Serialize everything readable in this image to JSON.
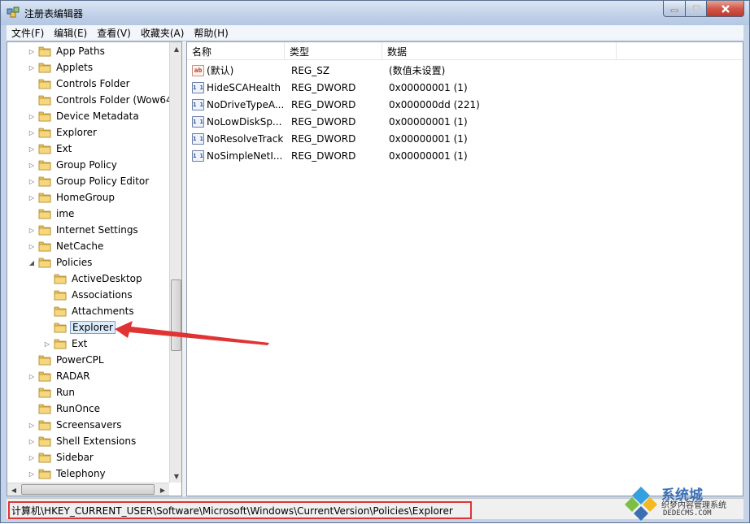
{
  "window": {
    "title": "注册表编辑器"
  },
  "menu": [
    "文件(F)",
    "编辑(E)",
    "查看(V)",
    "收藏夹(A)",
    "帮助(H)"
  ],
  "tree": {
    "items": [
      {
        "label": "App Paths",
        "level": 1,
        "expander": "collapsed"
      },
      {
        "label": "Applets",
        "level": 1,
        "expander": "collapsed"
      },
      {
        "label": "Controls Folder",
        "level": 1,
        "expander": "none"
      },
      {
        "label": "Controls Folder (Wow64",
        "level": 1,
        "expander": "none"
      },
      {
        "label": "Device Metadata",
        "level": 1,
        "expander": "collapsed"
      },
      {
        "label": "Explorer",
        "level": 1,
        "expander": "collapsed"
      },
      {
        "label": "Ext",
        "level": 1,
        "expander": "collapsed"
      },
      {
        "label": "Group Policy",
        "level": 1,
        "expander": "collapsed"
      },
      {
        "label": "Group Policy Editor",
        "level": 1,
        "expander": "collapsed"
      },
      {
        "label": "HomeGroup",
        "level": 1,
        "expander": "collapsed"
      },
      {
        "label": "ime",
        "level": 1,
        "expander": "none"
      },
      {
        "label": "Internet Settings",
        "level": 1,
        "expander": "collapsed"
      },
      {
        "label": "NetCache",
        "level": 1,
        "expander": "collapsed"
      },
      {
        "label": "Policies",
        "level": 1,
        "expander": "expanded"
      },
      {
        "label": "ActiveDesktop",
        "level": 2,
        "expander": "none"
      },
      {
        "label": "Associations",
        "level": 2,
        "expander": "none"
      },
      {
        "label": "Attachments",
        "level": 2,
        "expander": "none"
      },
      {
        "label": "Explorer",
        "level": 2,
        "expander": "none",
        "selected": true
      },
      {
        "label": "Ext",
        "level": 2,
        "expander": "collapsed"
      },
      {
        "label": "PowerCPL",
        "level": 1,
        "expander": "none"
      },
      {
        "label": "RADAR",
        "level": 1,
        "expander": "collapsed"
      },
      {
        "label": "Run",
        "level": 1,
        "expander": "none"
      },
      {
        "label": "RunOnce",
        "level": 1,
        "expander": "none"
      },
      {
        "label": "Screensavers",
        "level": 1,
        "expander": "collapsed"
      },
      {
        "label": "Shell Extensions",
        "level": 1,
        "expander": "collapsed"
      },
      {
        "label": "Sidebar",
        "level": 1,
        "expander": "collapsed"
      },
      {
        "label": "Telephony",
        "level": 1,
        "expander": "collapsed"
      }
    ]
  },
  "list": {
    "columns": [
      "名称",
      "类型",
      "数据"
    ],
    "rows": [
      {
        "icon": "ab",
        "name": "(默认)",
        "type": "REG_SZ",
        "data": "(数值未设置)"
      },
      {
        "icon": "dword",
        "name": "HideSCAHealth",
        "type": "REG_DWORD",
        "data": "0x00000001 (1)"
      },
      {
        "icon": "dword",
        "name": "NoDriveTypeA...",
        "type": "REG_DWORD",
        "data": "0x000000dd (221)"
      },
      {
        "icon": "dword",
        "name": "NoLowDiskSp...",
        "type": "REG_DWORD",
        "data": "0x00000001 (1)"
      },
      {
        "icon": "dword",
        "name": "NoResolveTrack",
        "type": "REG_DWORD",
        "data": "0x00000001 (1)"
      },
      {
        "icon": "dword",
        "name": "NoSimpleNetI...",
        "type": "REG_DWORD",
        "data": "0x00000001 (1)"
      }
    ]
  },
  "status": {
    "path": "计算机\\HKEY_CURRENT_USER\\Software\\Microsoft\\Windows\\CurrentVersion\\Policies\\Explorer"
  },
  "watermark": {
    "title": "系统城",
    "subtitle": "织梦内容管理系统",
    "url": "DEDECMS.COM"
  },
  "colors": {
    "highlight_border": "#e03434",
    "selection": "#dcecfc",
    "titlebar": "#bfd0e8"
  }
}
